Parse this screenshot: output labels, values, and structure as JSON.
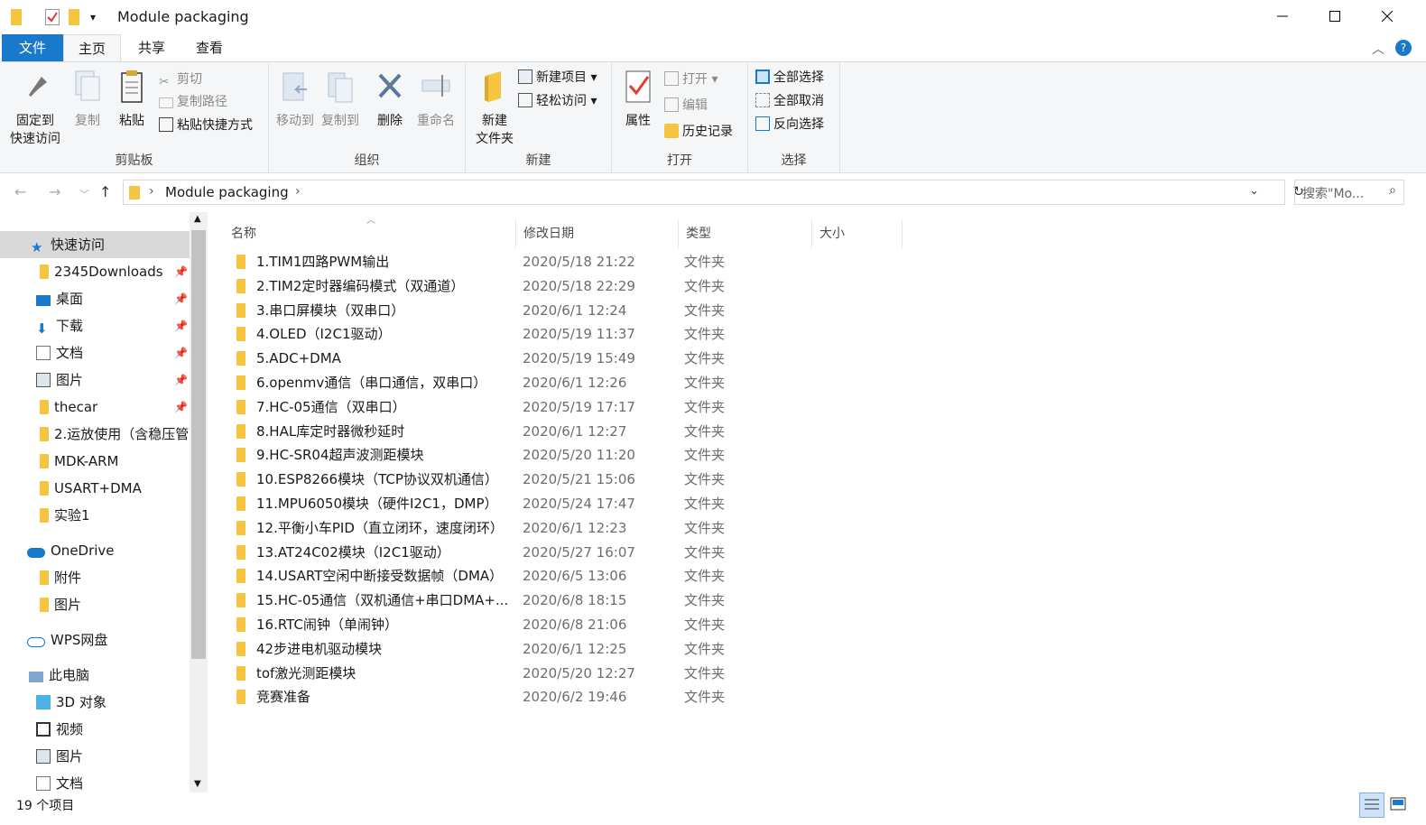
{
  "titlebar": {
    "title": "Module packaging",
    "quick_access_overflow": "▾"
  },
  "ribbon": {
    "tabs": [
      {
        "label": "文件"
      },
      {
        "label": "主页"
      },
      {
        "label": "共享"
      },
      {
        "label": "查看"
      }
    ],
    "clipboard": {
      "group_label": "剪贴板",
      "pin_line1": "固定到",
      "pin_line2": "快速访问",
      "copy": "复制",
      "paste": "粘贴",
      "cut": "剪切",
      "copy_path": "复制路径",
      "paste_shortcut": "粘贴快捷方式"
    },
    "organize": {
      "group_label": "组织",
      "move_to": "移动到",
      "copy_to": "复制到",
      "delete": "删除",
      "rename": "重命名"
    },
    "new": {
      "group_label": "新建",
      "new_folder_line1": "新建",
      "new_folder_line2": "文件夹",
      "new_item": "新建项目 ▾",
      "easy_access": "轻松访问 ▾"
    },
    "open": {
      "group_label": "打开",
      "properties": "属性",
      "open": "打开 ▾",
      "edit": "编辑",
      "history": "历史记录"
    },
    "select": {
      "group_label": "选择",
      "select_all": "全部选择",
      "select_none": "全部取消",
      "invert": "反向选择"
    }
  },
  "addressbar": {
    "path": "Module packaging",
    "search_placeholder": "搜索\"Mo..."
  },
  "navpane": {
    "items": [
      {
        "label": "快速访问",
        "pinned": false
      },
      {
        "label": "2345Downloads",
        "pinned": true
      },
      {
        "label": "桌面",
        "pinned": true
      },
      {
        "label": "下载",
        "pinned": true
      },
      {
        "label": "文档",
        "pinned": true
      },
      {
        "label": "图片",
        "pinned": true
      },
      {
        "label": "thecar",
        "pinned": true
      },
      {
        "label": "2.运放使用（含稳压管",
        "pinned": false
      },
      {
        "label": "MDK-ARM",
        "pinned": false
      },
      {
        "label": "USART+DMA",
        "pinned": false
      },
      {
        "label": "实验1",
        "pinned": false
      },
      {
        "label": "OneDrive",
        "pinned": false
      },
      {
        "label": "附件",
        "pinned": false
      },
      {
        "label": "图片",
        "pinned": false
      },
      {
        "label": "WPS网盘",
        "pinned": false
      },
      {
        "label": "此电脑",
        "pinned": false
      },
      {
        "label": "3D 对象",
        "pinned": false
      },
      {
        "label": "视频",
        "pinned": false
      },
      {
        "label": "图片",
        "pinned": false
      },
      {
        "label": "文档",
        "pinned": false
      }
    ],
    "pin_glyph": "📌"
  },
  "filelist": {
    "columns": [
      {
        "label": "名称"
      },
      {
        "label": "修改日期"
      },
      {
        "label": "类型"
      },
      {
        "label": "大小"
      }
    ],
    "rows": [
      {
        "name": "1.TIM1四路PWM输出",
        "date": "2020/5/18 21:22",
        "type": "文件夹"
      },
      {
        "name": "2.TIM2定时器编码模式（双通道）",
        "date": "2020/5/18 22:29",
        "type": "文件夹"
      },
      {
        "name": "3.串口屏模块（双串口）",
        "date": "2020/6/1 12:24",
        "type": "文件夹"
      },
      {
        "name": "4.OLED（I2C1驱动）",
        "date": "2020/5/19 11:37",
        "type": "文件夹"
      },
      {
        "name": "5.ADC+DMA",
        "date": "2020/5/19 15:49",
        "type": "文件夹"
      },
      {
        "name": "6.openmv通信（串口通信，双串口）",
        "date": "2020/6/1 12:26",
        "type": "文件夹"
      },
      {
        "name": "7.HC-05通信（双串口）",
        "date": "2020/5/19 17:17",
        "type": "文件夹"
      },
      {
        "name": "8.HAL库定时器微秒延时",
        "date": "2020/6/1 12:27",
        "type": "文件夹"
      },
      {
        "name": "9.HC-SR04超声波测距模块",
        "date": "2020/5/20 11:20",
        "type": "文件夹"
      },
      {
        "name": "10.ESP8266模块（TCP协议双机通信）",
        "date": "2020/5/21 15:06",
        "type": "文件夹"
      },
      {
        "name": "11.MPU6050模块（硬件I2C1，DMP）",
        "date": "2020/5/24 17:47",
        "type": "文件夹"
      },
      {
        "name": "12.平衡小车PID（直立闭环，速度闭环）",
        "date": "2020/6/1 12:23",
        "type": "文件夹"
      },
      {
        "name": "13.AT24C02模块（I2C1驱动）",
        "date": "2020/5/27 16:07",
        "type": "文件夹"
      },
      {
        "name": "14.USART空闲中断接受数据帧（DMA）",
        "date": "2020/6/5 13:06",
        "type": "文件夹"
      },
      {
        "name": "15.HC-05通信（双机通信+串口DMA+...",
        "date": "2020/6/8 18:15",
        "type": "文件夹"
      },
      {
        "name": "16.RTC闹钟（单闹钟）",
        "date": "2020/6/8 21:06",
        "type": "文件夹"
      },
      {
        "name": "42步进电机驱动模块",
        "date": "2020/6/1 12:25",
        "type": "文件夹"
      },
      {
        "name": "tof激光测距模块",
        "date": "2020/5/20 12:27",
        "type": "文件夹"
      },
      {
        "name": "竞赛准备",
        "date": "2020/6/2 19:46",
        "type": "文件夹"
      }
    ]
  },
  "statusbar": {
    "count": "19 个项目"
  },
  "colors": {
    "accent": "#1979ca",
    "folder": "#f5c542",
    "selected_nav": "#d9d9d9"
  }
}
